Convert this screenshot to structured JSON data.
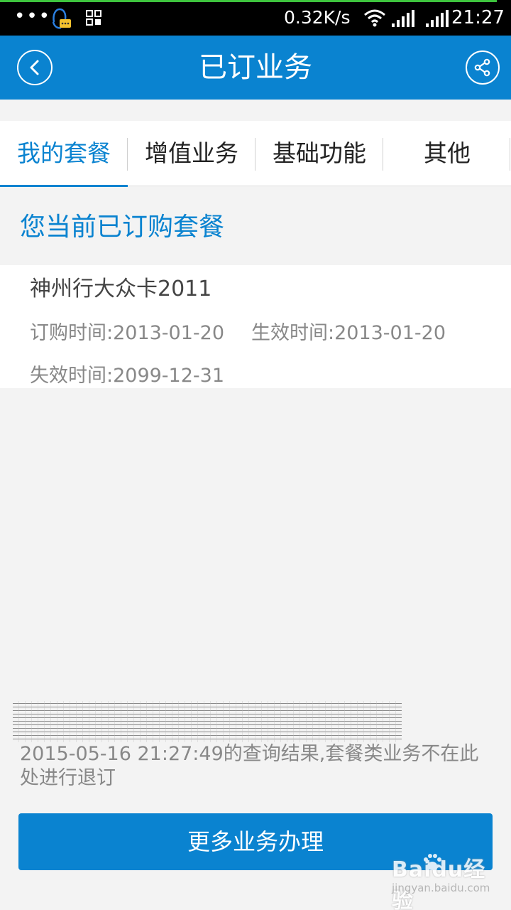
{
  "status_bar": {
    "dots": "•••",
    "net_speed": "0.32K/s",
    "clock": "21:27",
    "icons": [
      "qq-icon",
      "apps-icon",
      "wifi-icon",
      "signal-icon",
      "signal-icon"
    ]
  },
  "header": {
    "title": "已订业务",
    "back_icon": "back-icon",
    "share_icon": "share-icon",
    "background_color": "#0a83d0"
  },
  "tabs": [
    {
      "label": "我的套餐",
      "active": true
    },
    {
      "label": "增值业务",
      "active": false
    },
    {
      "label": "基础功能",
      "active": false
    },
    {
      "label": "其他",
      "active": false
    }
  ],
  "section": {
    "title": "您当前已订购套餐"
  },
  "package": {
    "name": "神州行大众卡2011",
    "order_time": "订购时间:2013-01-20",
    "effective_time": "生效时间:2013-01-20",
    "expire_time": "失效时间:2099-12-31"
  },
  "footer": {
    "query_info": "2015-05-16 21:27:49的查询结果,套餐类业务不在此处进行退订",
    "more_button_label": "更多业务办理"
  },
  "watermark": {
    "logo": "Baidu经验",
    "url": "jingyan.baidu.com"
  },
  "colors": {
    "accent": "#0a83d0",
    "background": "#f3f3f3",
    "secondary_text": "#888888"
  }
}
